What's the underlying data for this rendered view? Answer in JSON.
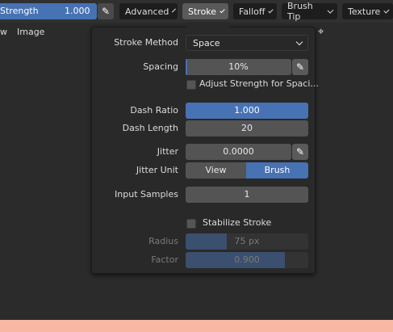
{
  "header": {
    "strength_label": "Strength",
    "strength_value": "1.000",
    "strength_pen_icon": "pen-pressure-icon",
    "menus": [
      {
        "label": "Advanced"
      },
      {
        "label": "Stroke"
      },
      {
        "label": "Falloff"
      },
      {
        "label": "Brush Tip"
      },
      {
        "label": "Texture"
      }
    ]
  },
  "menubar": {
    "view_label": "w",
    "image_label": "Image",
    "pin_icon": "pin-icon"
  },
  "stroke_panel": {
    "stroke_method": {
      "label": "Stroke Method",
      "value": "Space"
    },
    "spacing": {
      "label": "Spacing",
      "value": "10%",
      "fill_percent": 10
    },
    "adjust_strength": {
      "label": "Adjust Strength for Spaci...",
      "checked": false
    },
    "dash_ratio": {
      "label": "Dash Ratio",
      "value": "1.000"
    },
    "dash_length": {
      "label": "Dash Length",
      "value": "20"
    },
    "jitter": {
      "label": "Jitter",
      "value": "0.0000"
    },
    "jitter_unit": {
      "label": "Jitter Unit",
      "options": [
        "View",
        "Brush"
      ],
      "selected": "Brush"
    },
    "input_samples": {
      "label": "Input Samples",
      "value": "1"
    },
    "stabilize_stroke": {
      "label": "Stabilize Stroke",
      "checked": false
    },
    "radius": {
      "label": "Radius",
      "value": "75 px",
      "fill_percent": 34
    },
    "factor": {
      "label": "Factor",
      "value": "0.900",
      "fill_percent": 81
    }
  },
  "colors": {
    "accent": "#4772b3",
    "panel_bg": "#292929",
    "bottom_strip": "#f7b7a3"
  }
}
